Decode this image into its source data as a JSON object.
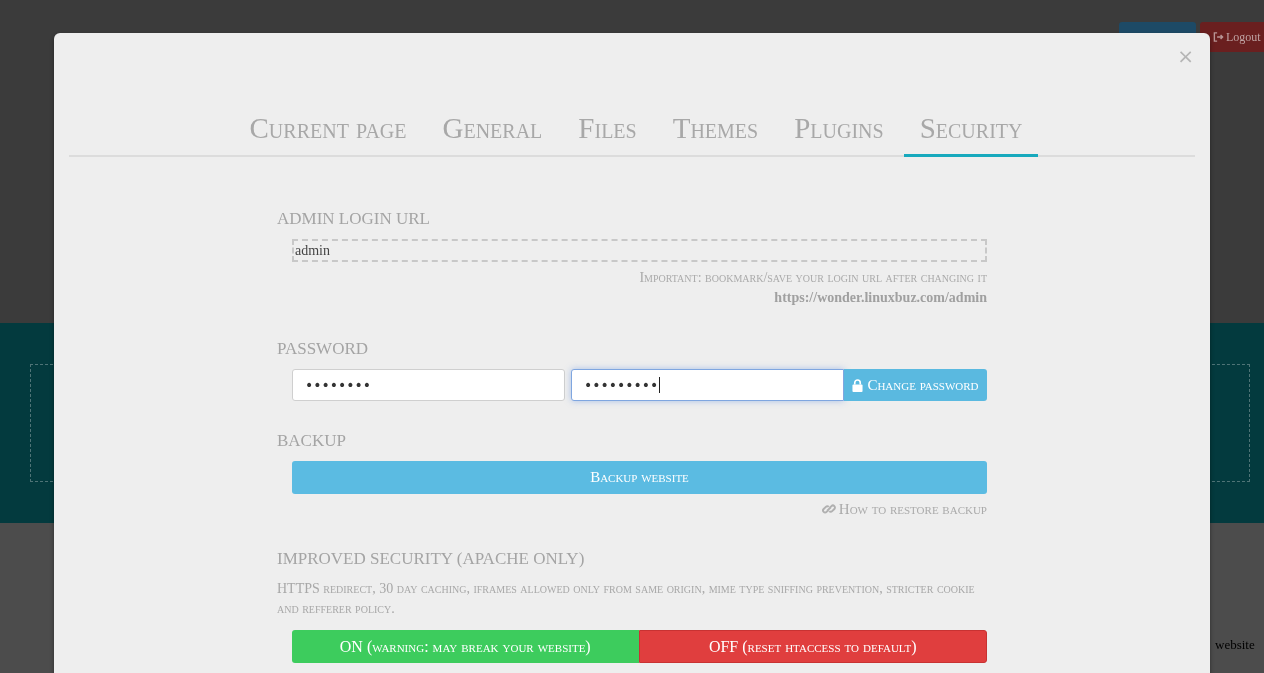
{
  "header_buttons": [
    {
      "kind": "primary"
    },
    {
      "kind": "danger",
      "label": "Logout"
    }
  ],
  "footer_text": "website",
  "modal": {
    "close_label": "×",
    "tabs": [
      {
        "label": "Current page",
        "selected": false
      },
      {
        "label": "General",
        "selected": false
      },
      {
        "label": "Files",
        "selected": false
      },
      {
        "label": "Themes",
        "selected": false
      },
      {
        "label": "Plugins",
        "selected": false
      },
      {
        "label": "Security",
        "selected": true
      }
    ],
    "sections": [
      {
        "kind": "login_url",
        "heading": "ADMIN LOGIN URL",
        "value": "admin",
        "note": "Important: bookmark/save your login url after changing it",
        "url": "https://wonder.linuxbuz.com/admin"
      },
      {
        "kind": "password",
        "heading": "PASSWORD",
        "fields": [
          {
            "value": "••••••••",
            "focused": false
          },
          {
            "value": "•••••••••",
            "focused": true
          }
        ],
        "button": "Change password"
      },
      {
        "kind": "backup",
        "heading": "BACKUP",
        "button": "Backup website",
        "link": "How to restore backup"
      },
      {
        "kind": "toggle",
        "heading": "IMPROVED SECURITY (APACHE ONLY)",
        "description": "HTTPS redirect, 30 day caching, iframes allowed only from same origin, mime type sniffing prevention, stricter cookie and refferer policy.",
        "options": [
          {
            "kind": "on",
            "label": "ON (warning: may break your website)"
          },
          {
            "kind": "off",
            "label": "OFF (reset htaccess to default)"
          }
        ]
      }
    ]
  }
}
